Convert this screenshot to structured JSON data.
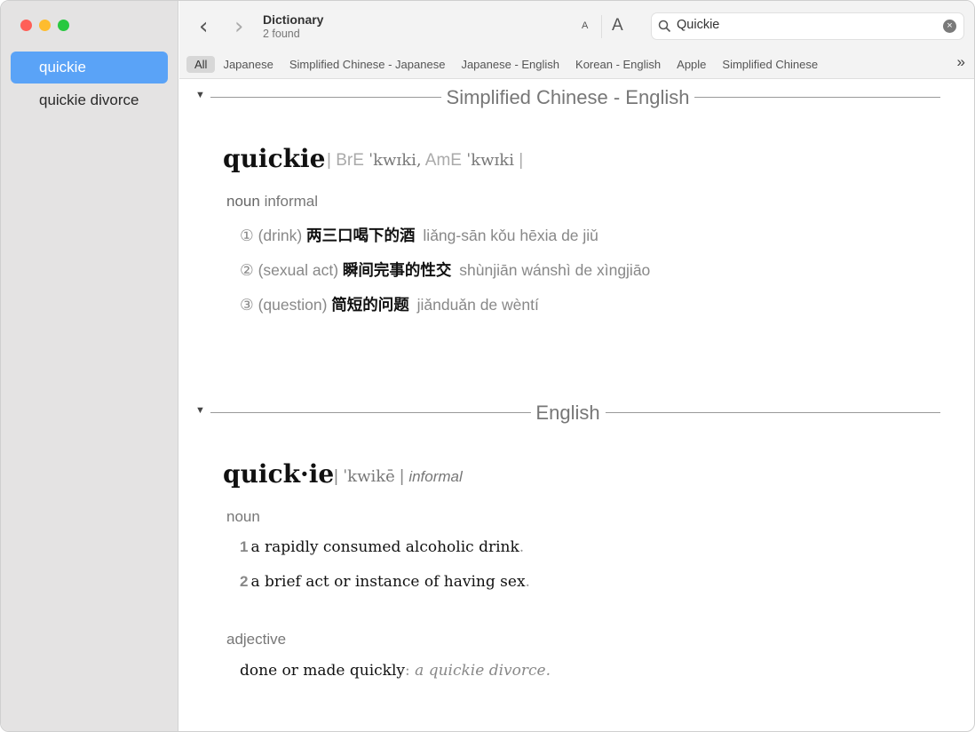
{
  "window": {
    "title": "Dictionary",
    "subtitle": "2 found",
    "lights": {
      "close": "#ff5f57",
      "minimize": "#febc2e",
      "zoom": "#28c840"
    }
  },
  "sidebar": {
    "items": [
      {
        "label": "quickie",
        "selected": true
      },
      {
        "label": "quickie divorce",
        "selected": false
      }
    ]
  },
  "toolbar": {
    "back": "‹",
    "forward": "›",
    "font_smaller": "A",
    "font_larger": "A",
    "search_value": "Quickie",
    "clear": "×",
    "more": "»"
  },
  "tabs": [
    {
      "label": "All",
      "selected": true
    },
    {
      "label": "Japanese"
    },
    {
      "label": "Simplified Chinese - Japanese"
    },
    {
      "label": "Japanese - English"
    },
    {
      "label": "Korean - English"
    },
    {
      "label": "Apple"
    },
    {
      "label": "Simplified Chinese"
    }
  ],
  "sections": [
    {
      "title": "Simplified Chinese - English",
      "headword": "quickie",
      "pron_open": "| BrE ",
      "pron_bre": "ˈkwɪki,",
      "pron_ame_label": " AmE ",
      "pron_ame": "ˈkwɪki",
      "pron_close": " |",
      "pos": "noun",
      "register": "informal",
      "senses": [
        {
          "num": "①",
          "gloss": "(drink)",
          "zh": "两三口喝下的酒",
          "pinyin": "liǎng-sān kǒu hēxia de jiǔ"
        },
        {
          "num": "②",
          "gloss": "(sexual act)",
          "zh": "瞬间完事的性交",
          "pinyin": "shùnjiān wánshì de xìngjiāo"
        },
        {
          "num": "③",
          "gloss": "(question)",
          "zh": "简短的问题",
          "pinyin": "jiǎnduǎn de wèntí"
        }
      ]
    },
    {
      "title": "English",
      "headword": "quick·ie",
      "pron_open": "| ",
      "pron": "ˈkwikē",
      "pron_close": " |",
      "register": "informal",
      "noun": {
        "label": "noun",
        "senses": [
          {
            "num": "1",
            "text": "a rapidly consumed alcoholic drink",
            "end": "."
          },
          {
            "num": "2",
            "text": "a brief act or instance of having sex",
            "end": "."
          }
        ]
      },
      "adjective": {
        "label": "adjective",
        "text": "done or made quickly",
        "colon": ":",
        "example": "a quickie divorce."
      }
    }
  ]
}
